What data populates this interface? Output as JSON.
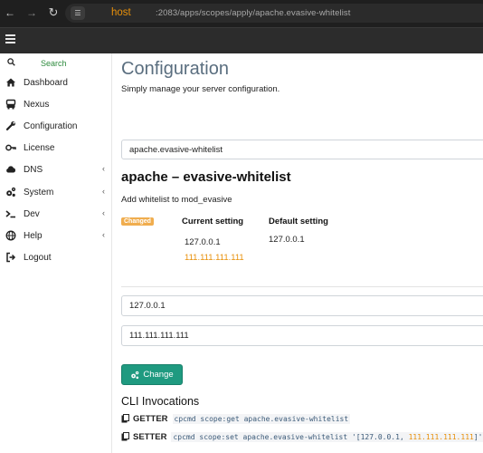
{
  "browser": {
    "url_host": "host",
    "url_path": ":2083/apps/scopes/apply/apache.evasive-whitelist",
    "back_icon": "arrow-left-icon",
    "forward_icon": "arrow-right-icon",
    "reload_icon": "reload-icon"
  },
  "sidebar": {
    "search_label": "Search",
    "items": [
      {
        "label": "Dashboard",
        "icon": "home-icon",
        "has_submenu": false
      },
      {
        "label": "Nexus",
        "icon": "server-icon",
        "has_submenu": false
      },
      {
        "label": "Configuration",
        "icon": "wrench-icon",
        "has_submenu": false
      },
      {
        "label": "License",
        "icon": "key-icon",
        "has_submenu": false
      },
      {
        "label": "DNS",
        "icon": "cloud-icon",
        "has_submenu": true
      },
      {
        "label": "System",
        "icon": "cogs-icon",
        "has_submenu": true
      },
      {
        "label": "Dev",
        "icon": "terminal-icon",
        "has_submenu": true
      },
      {
        "label": "Help",
        "icon": "globe-icon",
        "has_submenu": true
      },
      {
        "label": "Logout",
        "icon": "sign-out-icon",
        "has_submenu": false
      }
    ],
    "chevron": "‹"
  },
  "main": {
    "title": "Configuration",
    "subtitle": "Simply manage your server configuration.",
    "scope_select_value": "apache.evasive-whitelist",
    "scope_title": "apache – evasive-whitelist",
    "scope_description": "Add whitelist to mod_evasive",
    "changed_badge": "Changed",
    "current_header": "Current setting",
    "default_header": "Default setting",
    "current_values": [
      "127.0.0.1",
      "111.111.111.111"
    ],
    "default_values": [
      "127.0.0.1"
    ],
    "inputs": [
      "127.0.0.1",
      "111.111.111.111"
    ],
    "change_button": "Change",
    "cli_title": "CLI Invocations",
    "getter_label": "GETTER",
    "getter_cmd": "cpcmd scope:get apache.evasive-whitelist",
    "setter_label": "SETTER",
    "setter_cmd_prefix": "cpcmd scope:set apache.evasive-whitelist '[127.0.0.1, ",
    "setter_cmd_highlight": "111.111.111.111",
    "setter_cmd_suffix": "]'"
  },
  "colors": {
    "accent_orange": "#e8900a",
    "button_teal": "#1f9a80",
    "search_green": "#2e8b3e",
    "title_slate": "#5a6e7f"
  }
}
